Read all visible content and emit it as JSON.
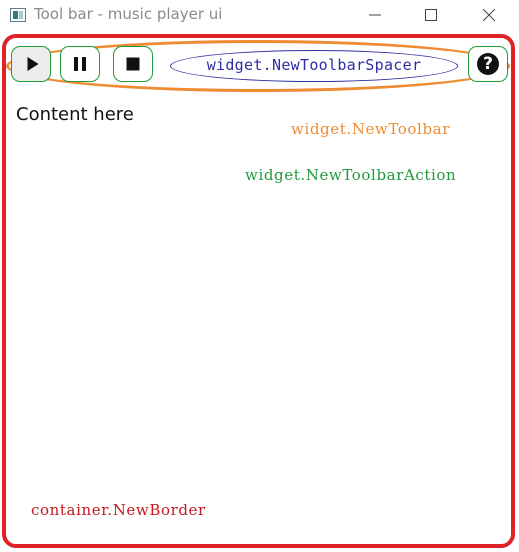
{
  "window": {
    "title": "Tool bar - music player ui",
    "controls": {
      "minimize_icon": "minimize-icon",
      "maximize_icon": "maximize-icon",
      "close_icon": "close-icon"
    }
  },
  "toolbar": {
    "actions": [
      {
        "name": "play",
        "icon": "play-icon",
        "state": "pressed"
      },
      {
        "name": "pause",
        "icon": "pause-icon"
      },
      {
        "name": "stop",
        "icon": "stop-icon"
      }
    ],
    "spacer_label": "widget.NewToolbarSpacer",
    "help_action": {
      "icon": "help-icon",
      "glyph": "?"
    }
  },
  "content": {
    "text": "Content here"
  },
  "annotations": {
    "toolbar": "widget.NewToolbar",
    "toolbar_action": "widget.NewToolbarAction",
    "border": "container.NewBorder"
  },
  "colors": {
    "border_outline": "#e02127",
    "toolbar_outline": "#ef8b32",
    "action_outline": "#1f9a3a",
    "spacer_outline": "#2d2fa3"
  }
}
